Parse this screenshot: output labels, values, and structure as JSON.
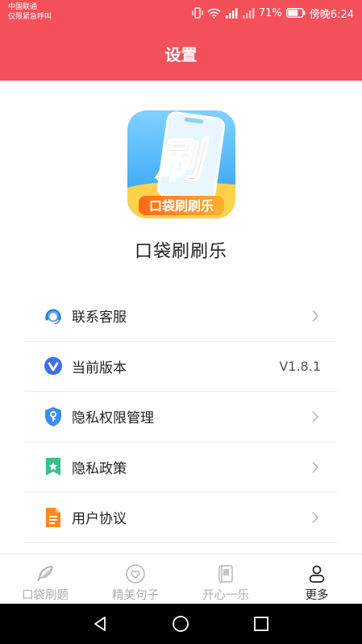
{
  "status": {
    "carrier_line1": "中国联通",
    "carrier_line2": "仅限紧急呼叫",
    "battery": "71%",
    "time": "傍晚6:24"
  },
  "header": {
    "title": "设置"
  },
  "app": {
    "name": "口袋刷刷乐",
    "logo_glyph": "刷",
    "logo_banner": "口袋刷刷乐"
  },
  "menu": [
    {
      "label": "联系客服",
      "icon": "headset-icon"
    },
    {
      "label": "当前版本",
      "icon": "version-v-icon",
      "value": "V1.8.1"
    },
    {
      "label": "隐私权限管理",
      "icon": "shield-key-icon"
    },
    {
      "label": "隐私政策",
      "icon": "bookmark-star-icon"
    },
    {
      "label": "用户协议",
      "icon": "document-icon"
    }
  ],
  "tabs": [
    {
      "label": "口袋刷题",
      "icon": "feather-icon"
    },
    {
      "label": "精美句子",
      "icon": "heart-icon"
    },
    {
      "label": "开心一乐",
      "icon": "book-icon"
    },
    {
      "label": "更多",
      "icon": "user-icon",
      "active": true
    }
  ],
  "colors": {
    "brand": "#f4505a",
    "active_tab": "#222222",
    "inactive_tab": "#b0b0b0"
  }
}
